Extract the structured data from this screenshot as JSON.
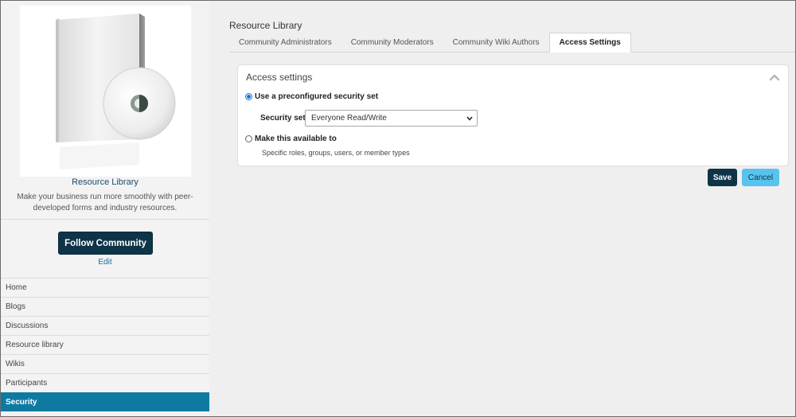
{
  "community": {
    "name": "Resource Library",
    "description": "Make your business run more smoothly with peer-developed forms and industry resources.",
    "follow_label": "Follow Community",
    "edit_label": "Edit"
  },
  "sidebar": {
    "items": [
      {
        "label": "Home",
        "active": false
      },
      {
        "label": "Blogs",
        "active": false
      },
      {
        "label": "Discussions",
        "active": false
      },
      {
        "label": "Resource library",
        "active": false
      },
      {
        "label": "Wikis",
        "active": false
      },
      {
        "label": "Participants",
        "active": false
      },
      {
        "label": "Security",
        "active": true
      }
    ]
  },
  "main": {
    "title": "Resource Library",
    "tabs": [
      {
        "label": "Community Administrators",
        "active": false
      },
      {
        "label": "Community Moderators",
        "active": false
      },
      {
        "label": "Community Wiki Authors",
        "active": false
      },
      {
        "label": "Access Settings",
        "active": true
      }
    ]
  },
  "access": {
    "panel_title": "Access settings",
    "option_preconfigured": "Use a preconfigured security set",
    "security_set_label": "Security set",
    "security_set_value": "Everyone Read/Write",
    "option_custom": "Make this available to",
    "custom_hint": "Specific roles, groups, users, or member types",
    "selected_option": "preconfigured"
  },
  "actions": {
    "save_label": "Save",
    "cancel_label": "Cancel"
  },
  "colors": {
    "primary_dark": "#0e3448",
    "active_nav": "#0f7aa1",
    "cancel": "#58c3ee",
    "link": "#1e6a9c"
  },
  "icons": {
    "collapse": "chevron-up-icon",
    "select_arrow": "chevron-down-icon"
  }
}
